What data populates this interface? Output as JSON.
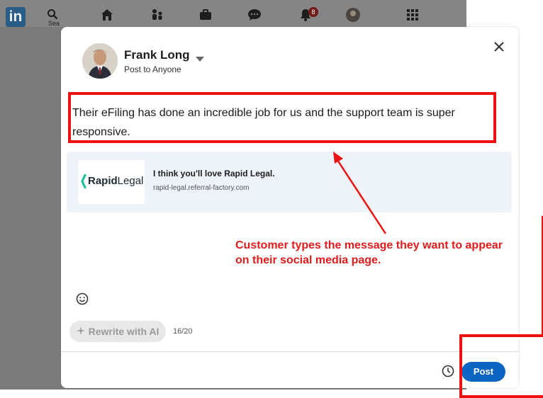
{
  "background": {
    "logo_text": "in",
    "search_label": "Sea",
    "notifications_count": "8",
    "nav_icons": [
      "search-icon",
      "home-icon",
      "my-network-icon",
      "jobs-icon",
      "messaging-icon",
      "notifications-icon",
      "profile-icon",
      "apps-grid-icon"
    ]
  },
  "composer": {
    "author_name": "Frank Long",
    "audience": "Post to Anyone",
    "message": "Their eFiling has done an incredible job for us and the support team is super responsive.",
    "link_preview": {
      "logo_bold": "Rapid",
      "logo_light": "Legal",
      "title": "I think you'll love Rapid Legal.",
      "url": "rapid-legal.referral-factory.com"
    },
    "rewrite_label": "Rewrite with AI",
    "char_count": "16/20",
    "post_label": "Post"
  },
  "annotation": {
    "text": "Customer types the message they want to appear on their social media page.",
    "color": "#ee1111"
  },
  "colors": {
    "accent": "#0a66c2",
    "link_card_bg": "#edf3f8",
    "brand_teal": "#1fbf9a"
  }
}
